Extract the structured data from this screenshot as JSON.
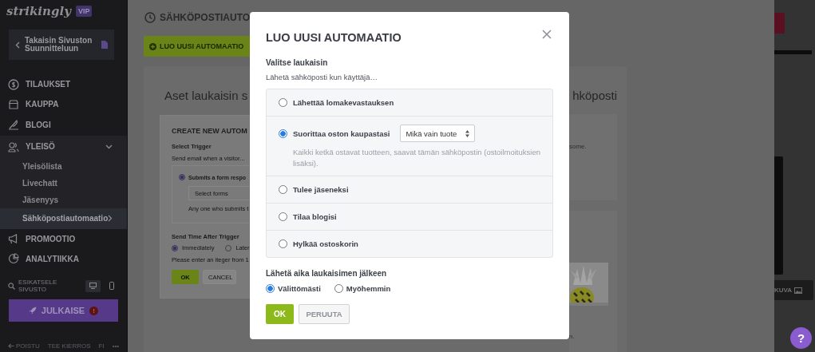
{
  "sidebar": {
    "logo": "strikingly",
    "badge": "VIP",
    "back_link": "Takaisin Sivuston Suunnitteluun",
    "nav": [
      {
        "label": "TILAUKSET",
        "selected": false,
        "expanded": false
      },
      {
        "label": "KAUPPA",
        "selected": false,
        "expanded": false
      },
      {
        "label": "BLOGI",
        "selected": false,
        "expanded": false
      },
      {
        "label": "YLEISÖ",
        "selected": true,
        "expanded": true,
        "children": [
          {
            "label": "Yleisölista",
            "selected": false
          },
          {
            "label": "Livechatt",
            "selected": false
          },
          {
            "label": "Jäsenyys",
            "selected": false
          },
          {
            "label": "Sähköpostiautomaatio",
            "selected": true
          }
        ]
      },
      {
        "label": "PROMOOTIO",
        "selected": false,
        "expanded": false
      },
      {
        "label": "ANALYTIIKKA",
        "selected": false,
        "expanded": false
      }
    ],
    "preview": {
      "label": "ESIKATSELE SIVUSTO",
      "devices": [
        {
          "kind": "desktop",
          "selected": true
        },
        {
          "kind": "mobile",
          "selected": false
        }
      ]
    },
    "publish": {
      "label": "JULKAISE",
      "alert": "!"
    },
    "footer": [
      {
        "kind": "exit",
        "label": "POISTU"
      },
      {
        "kind": "link",
        "label": "TEE KIERROS"
      },
      {
        "kind": "link",
        "label": "FI"
      },
      {
        "kind": "link",
        "label": "•••"
      }
    ]
  },
  "page": {
    "title": "SÄHKÖPOSTIAUTO",
    "new_button": "LUO UUSI AUTOMAATIO",
    "step_heading": "Aset laukaisin s",
    "preview_heading": "hköposti",
    "form": {
      "title": "CREATE NEW AUTOM",
      "trigger_label": "Select Trigger",
      "trigger_prompt": "Send email when a visitor...",
      "trigger_option": {
        "label": "Submits a form respo",
        "selected": true
      },
      "select_placeholder": "Select forms",
      "hint": "Any one who submits t",
      "time_label": "Send Time After Trigger",
      "time_options": [
        {
          "label": "Immediately",
          "selected": true
        },
        {
          "label": "Later",
          "selected": false
        }
      ],
      "error": "Please enter an iteger  from 1",
      "ok": "OK",
      "cancel": "CANCEL"
    },
    "preview_texts": [
      "some.",
      "n."
    ]
  },
  "right_strip": {
    "image_button": "KUVA"
  },
  "modal": {
    "title": "LUO UUSI AUTOMAATIO",
    "section_title": "Valitse laukaisin",
    "prompt": "Lähetä sähköposti kun käyttäjä…",
    "triggers": [
      {
        "label": "Lähettää lomakevastauksen",
        "selected": false
      },
      {
        "label": "Suorittaa oston kaupastasi",
        "selected": true,
        "select_value": "Mikä vain tuote",
        "description": "Kaikki ketkä ostavat tuotteen, saavat tämän sähköpostin (ostoilmoituksien lisäksi)."
      },
      {
        "label": "Tulee jäseneksi",
        "selected": false
      },
      {
        "label": "Tilaa blogisi",
        "selected": false
      },
      {
        "label": "Hylkää ostoskorin",
        "selected": false
      }
    ],
    "send_time_title": "Lähetä aika laukaisimen jälkeen",
    "send_time_options": [
      {
        "label": "Välittömästi",
        "selected": true
      },
      {
        "label": "Myöhemmin",
        "selected": false
      }
    ],
    "ok": "OK",
    "cancel": "PERUUTA"
  },
  "help": {
    "label": "?"
  }
}
